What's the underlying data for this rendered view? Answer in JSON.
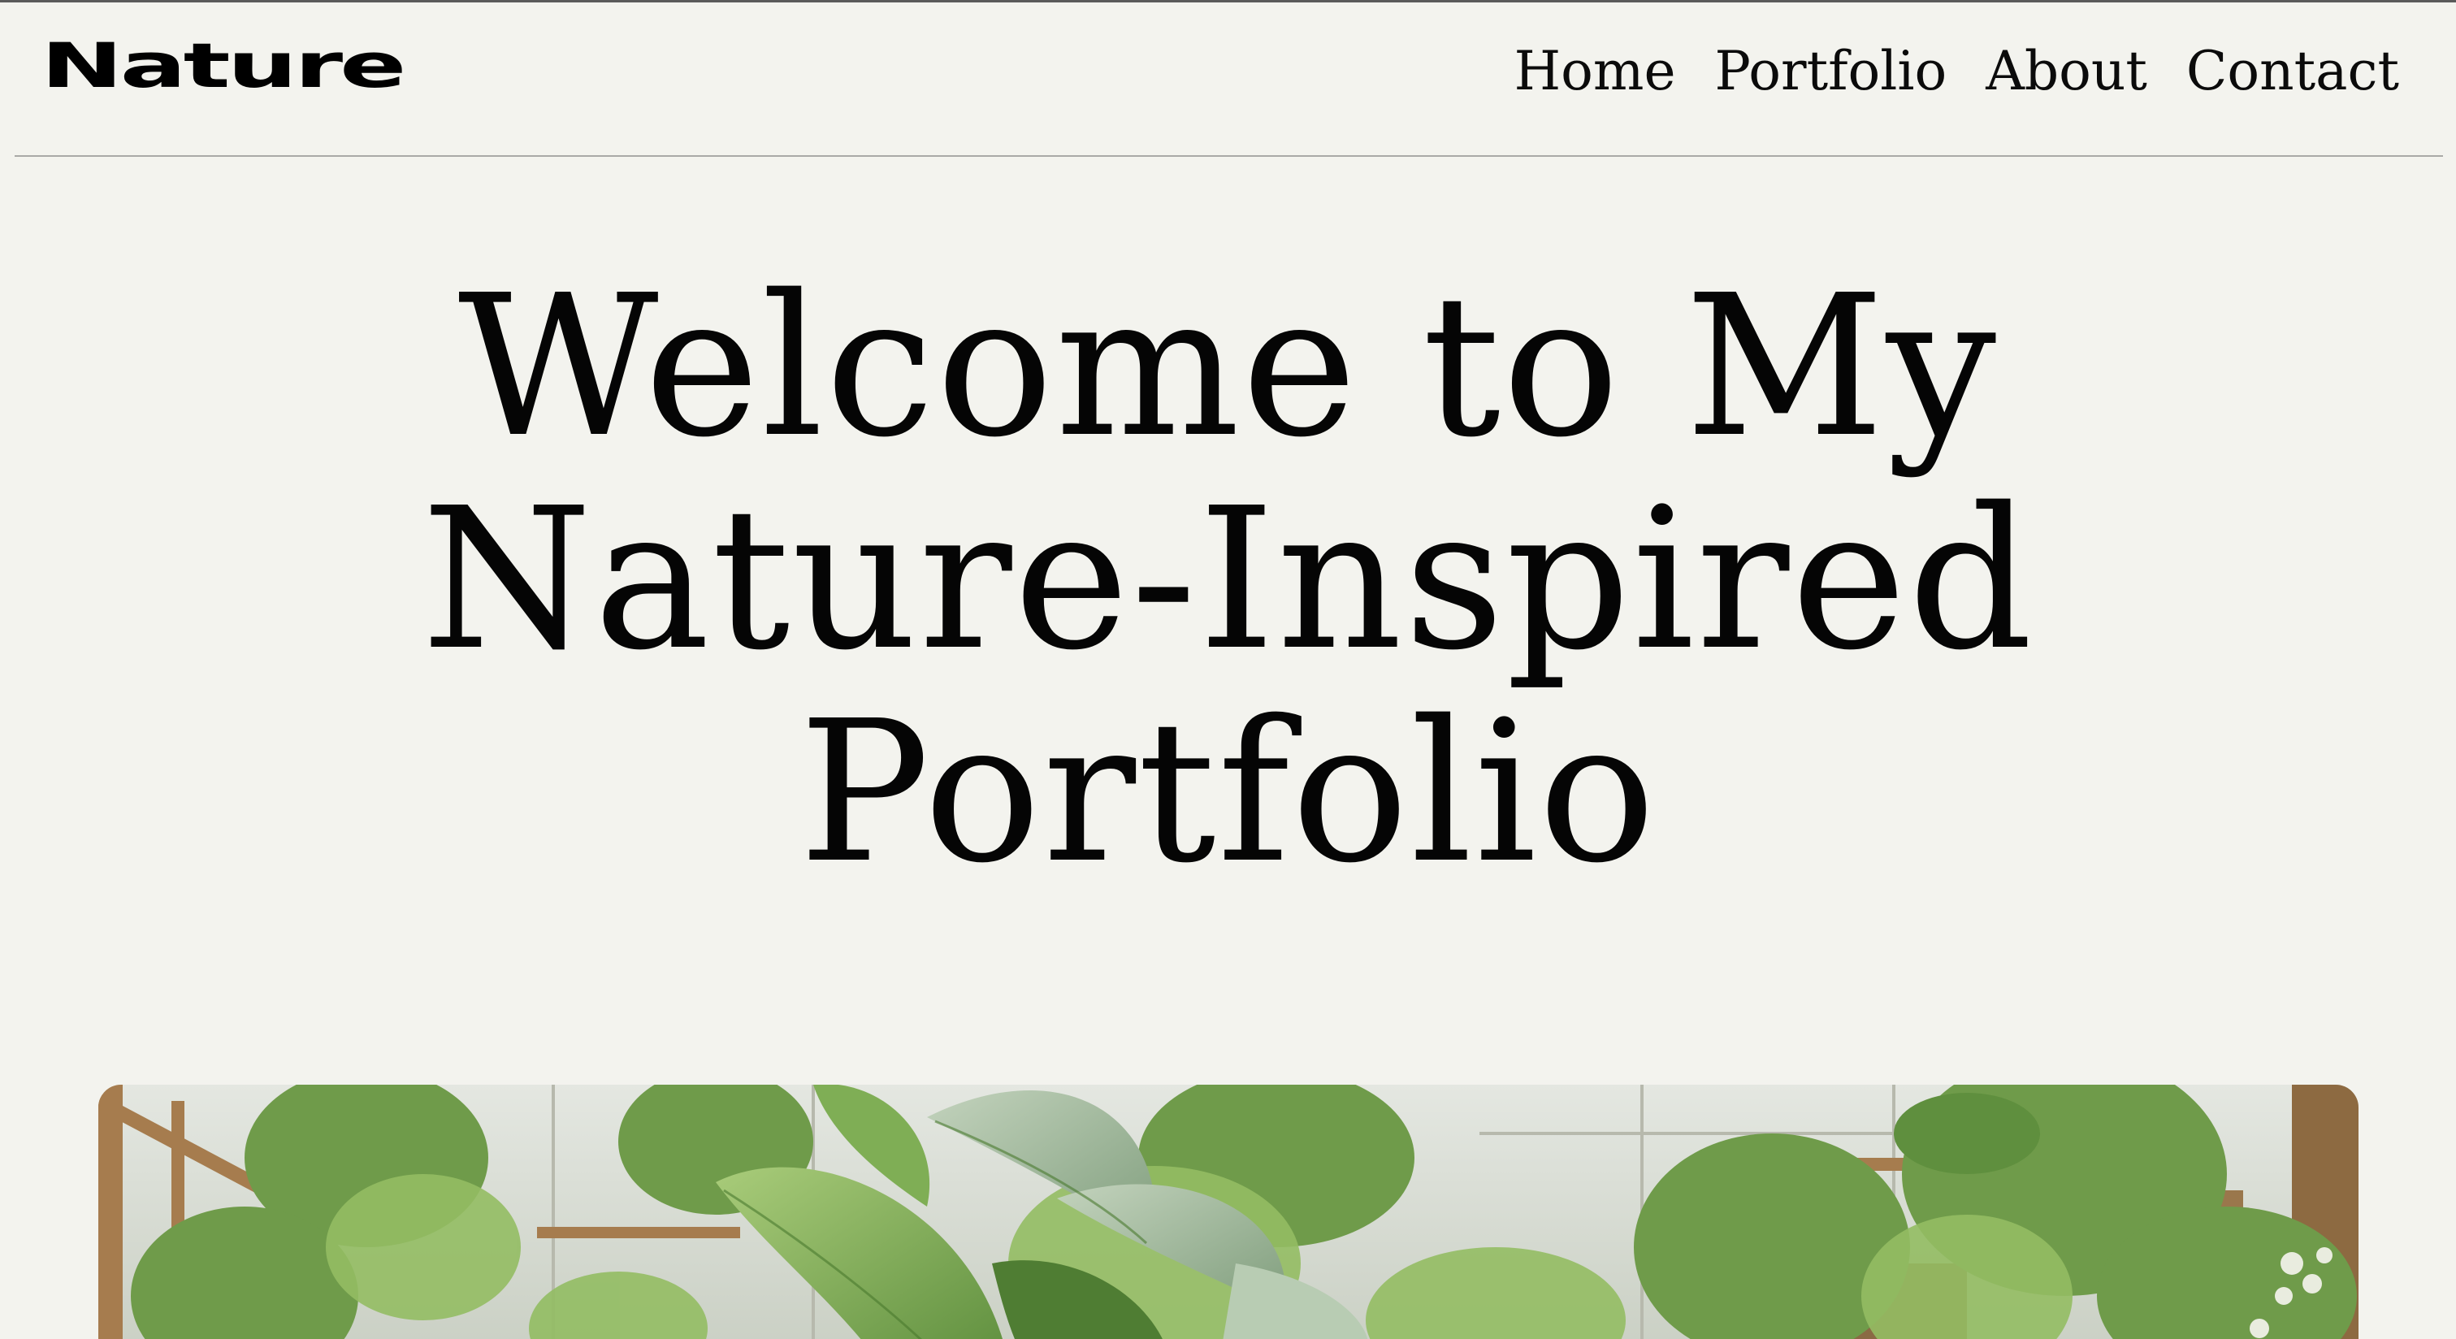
{
  "site": {
    "logo": "Nature"
  },
  "nav": {
    "items": [
      {
        "label": "Home"
      },
      {
        "label": "Portfolio"
      },
      {
        "label": "About"
      },
      {
        "label": "Contact"
      }
    ]
  },
  "hero": {
    "line1": "Welcome to My",
    "line2": "Nature-Inspired",
    "line3": "Portfolio",
    "image_subject": "greenhouse-plants-photo"
  },
  "colors": {
    "background": "#f3f3ee",
    "text": "#050505",
    "divider": "#a9a9a6",
    "foliage_dark": "#3f6b2c",
    "foliage_light": "#9cc46a",
    "wood": "#a67c4e"
  }
}
